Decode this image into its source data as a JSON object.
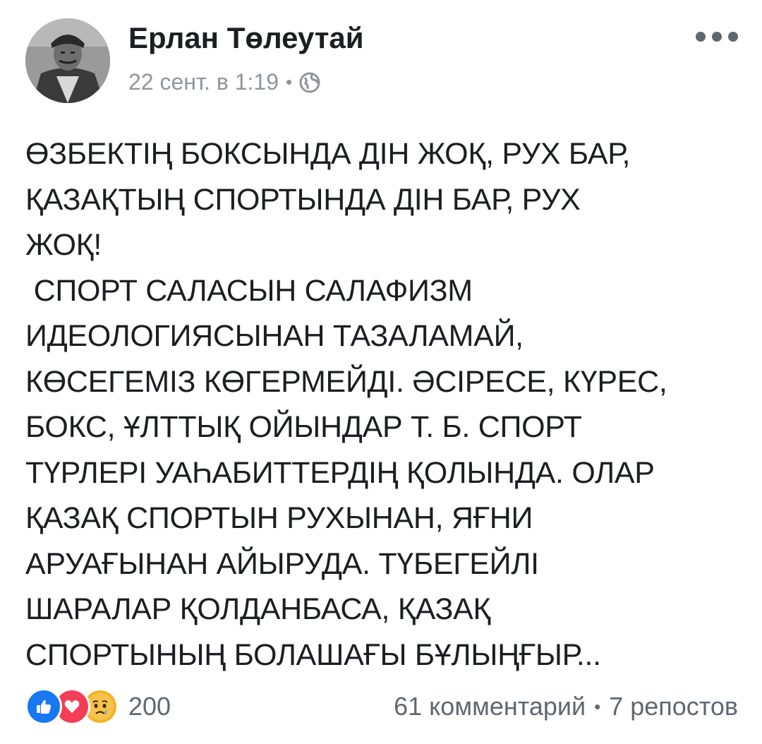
{
  "post": {
    "author": "Ерлан Төлеутай",
    "timestamp": "22 сент. в 1:19",
    "separator": "•",
    "privacy_icon": "globe-icon",
    "menu_icon": "more-icon",
    "text_lines": [
      "ӨЗБЕКТІҢ БОКСЫНДА ДІН ЖОҚ, РУХ БАР,",
      "ҚАЗАҚТЫҢ СПОРТЫНДА ДІН БАР, РУХ",
      "ЖОҚ!",
      " СПОРТ САЛАСЫН САЛАФИЗМ",
      "ИДЕОЛОГИЯСЫНАН ТАЗАЛАМАЙ,",
      "КӨСЕГЕМІЗ КӨГЕРМЕЙДІ. ӘСІРЕСЕ, КҮРЕС,",
      "БОКС, ҰЛТТЫҚ ОЙЫНДАР Т. Б. СПОРТ",
      "ТҮРЛЕРІ УАҺАБИТТЕРДІҢ ҚОЛЫНДА. ОЛАР",
      "ҚАЗАҚ СПОРТЫН РУХЫНАН, ЯҒНИ",
      "АРУАҒЫНАН АЙЫРУДА. ТҮБЕГЕЙЛІ",
      "ШАРАЛАР ҚОЛДАНБАСА, ҚАЗАҚ",
      "СПОРТЫНЫҢ БОЛАШАҒЫ БҰЛЫҢҒЫР..."
    ]
  },
  "footer": {
    "reactions": [
      "like-icon",
      "love-icon",
      "sad-icon"
    ],
    "reaction_count": "200",
    "comments": "61 комментарий",
    "separator": "•",
    "shares": "7 репостов"
  },
  "colors": {
    "text": "#1c1e21",
    "secondary": "#90949c",
    "footer_text": "#606770",
    "like": "#1877f2",
    "love": "#f33e58",
    "sad": "#f7b125"
  }
}
